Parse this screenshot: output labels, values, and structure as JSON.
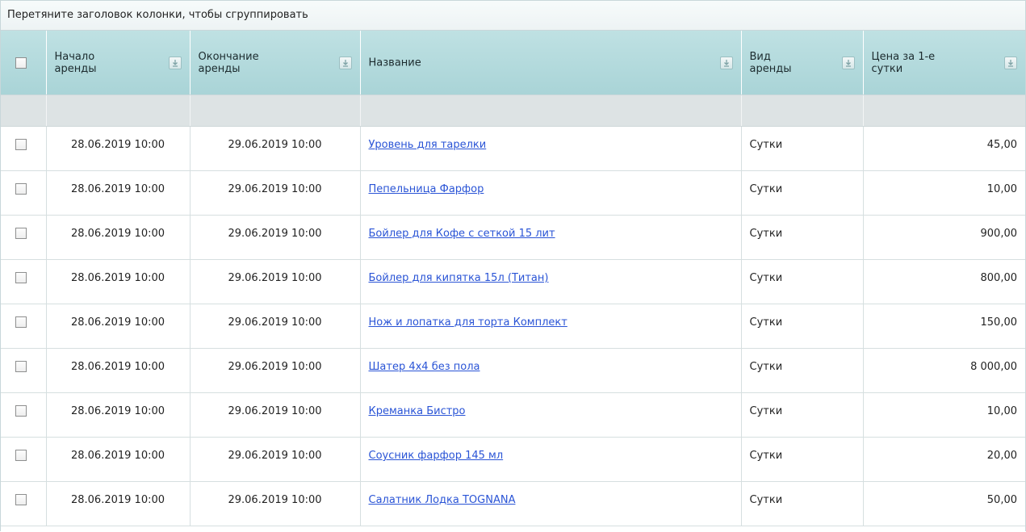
{
  "group_panel": {
    "hint": "Перетяните заголовок колонки, чтобы сгруппировать"
  },
  "columns": [
    {
      "label": ""
    },
    {
      "label": "Начало\nаренды"
    },
    {
      "label": "Окончание\nаренды"
    },
    {
      "label": "Название"
    },
    {
      "label": "Вид\nаренды"
    },
    {
      "label": "Цена за 1-е\nсутки"
    }
  ],
  "rows": [
    {
      "start": "28.06.2019 10:00",
      "end": "29.06.2019 10:00",
      "name": "Уровень для тарелки",
      "kind": "Сутки",
      "price": "45,00"
    },
    {
      "start": "28.06.2019 10:00",
      "end": "29.06.2019 10:00",
      "name": "Пепельница Фарфор",
      "kind": "Сутки",
      "price": "10,00"
    },
    {
      "start": "28.06.2019 10:00",
      "end": "29.06.2019 10:00",
      "name": "Бойлер для Кофе с сеткой 15 лит",
      "kind": "Сутки",
      "price": "900,00"
    },
    {
      "start": "28.06.2019 10:00",
      "end": "29.06.2019 10:00",
      "name": "Бойлер для кипятка 15л (Титан)",
      "kind": "Сутки",
      "price": "800,00"
    },
    {
      "start": "28.06.2019 10:00",
      "end": "29.06.2019 10:00",
      "name": "Нож и лопатка для торта Комплект",
      "kind": "Сутки",
      "price": "150,00"
    },
    {
      "start": "28.06.2019 10:00",
      "end": "29.06.2019 10:00",
      "name": "Шатер 4х4 без пола",
      "kind": "Сутки",
      "price": "8 000,00"
    },
    {
      "start": "28.06.2019 10:00",
      "end": "29.06.2019 10:00",
      "name": "Креманка Бистро",
      "kind": "Сутки",
      "price": "10,00"
    },
    {
      "start": "28.06.2019 10:00",
      "end": "29.06.2019 10:00",
      "name": "Соусник фарфор 145 мл",
      "kind": "Сутки",
      "price": "20,00"
    },
    {
      "start": "28.06.2019 10:00",
      "end": "29.06.2019 10:00",
      "name": "Салатник Лодка TOGNANA",
      "kind": "Сутки",
      "price": "50,00"
    }
  ]
}
